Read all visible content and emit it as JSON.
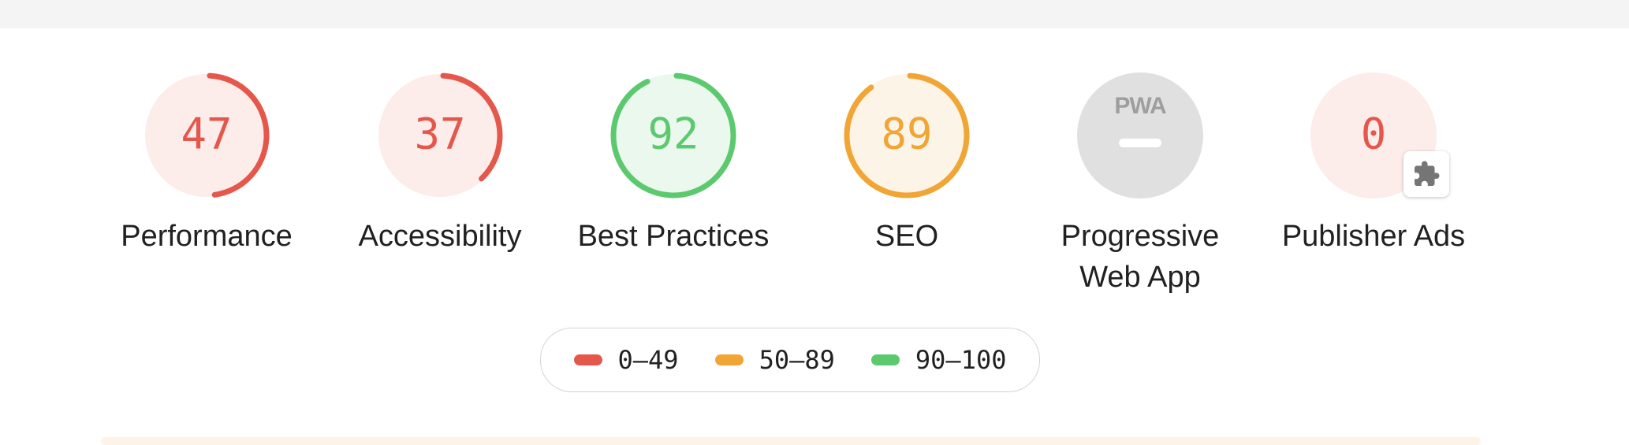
{
  "colors": {
    "fail": "#e5574b",
    "fail_bg": "#fcecea",
    "average": "#f0a534",
    "average_bg": "#fdf4e8",
    "pass": "#5dc96f",
    "pass_bg": "#ebf8ee",
    "na": "#9e9e9e",
    "na_bg": "#e0e0e0"
  },
  "gauges": [
    {
      "id": "performance",
      "label": "Performance",
      "score": "47",
      "fraction": 0.47,
      "rating": "fail"
    },
    {
      "id": "accessibility",
      "label": "Accessibility",
      "score": "37",
      "fraction": 0.37,
      "rating": "fail"
    },
    {
      "id": "best-practices",
      "label": "Best Practices",
      "score": "92",
      "fraction": 0.92,
      "rating": "pass"
    },
    {
      "id": "seo",
      "label": "SEO",
      "score": "89",
      "fraction": 0.89,
      "rating": "average"
    },
    {
      "id": "pwa",
      "label": "Progressive Web App",
      "badge": "PWA",
      "icon": "pwa-badge-icon",
      "rating": "na"
    },
    {
      "id": "publisher-ads",
      "label": "Publisher Ads",
      "score": "0",
      "fraction": 0.0,
      "rating": "fail",
      "icon": "puzzle-piece-icon"
    }
  ],
  "legend": [
    {
      "range": "0–49",
      "rating": "fail"
    },
    {
      "range": "50–89",
      "rating": "average"
    },
    {
      "range": "90–100",
      "rating": "pass"
    }
  ]
}
